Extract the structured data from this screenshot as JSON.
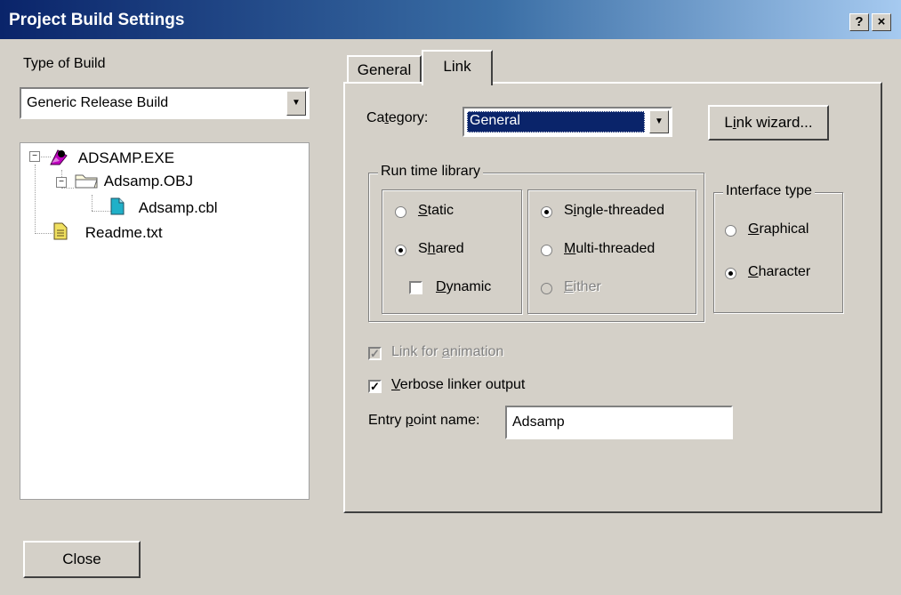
{
  "window": {
    "title": "Project Build Settings",
    "help_button": "?",
    "close_button": "×"
  },
  "type_of_build": {
    "label": "Type of Build",
    "selected": "Generic Release Build"
  },
  "tree": {
    "items": [
      {
        "label": "ADSAMP.EXE",
        "icon": "exe-icon"
      },
      {
        "label": "Adsamp.OBJ",
        "icon": "folder-icon"
      },
      {
        "label": "Adsamp.cbl",
        "icon": "cobol-file-icon"
      },
      {
        "label": "Readme.txt",
        "icon": "text-file-icon"
      }
    ]
  },
  "tabs": [
    {
      "label": "General",
      "active": false
    },
    {
      "label": "Link",
      "active": true
    }
  ],
  "category": {
    "label": "Category:",
    "selected": "General"
  },
  "link_wizard_button": "Link wizard...",
  "run_time_library": {
    "title": "Run time library",
    "static": "Static",
    "shared": "Shared",
    "dynamic": "Dynamic",
    "single_threaded": "Single-threaded",
    "multi_threaded": "Multi-threaded",
    "either": "Either"
  },
  "interface_type": {
    "title": "Interface type",
    "graphical": "Graphical",
    "character": "Character"
  },
  "link_for_animation": "Link for animation",
  "verbose_linker_output": "Verbose linker output",
  "entry_point": {
    "label": "Entry point name:",
    "value": "Adsamp"
  },
  "close_button": "Close",
  "colors": {
    "title_start": "#0a246a",
    "title_end": "#a6caf0",
    "face": "#d4d0c8",
    "selection": "#0a246a"
  }
}
